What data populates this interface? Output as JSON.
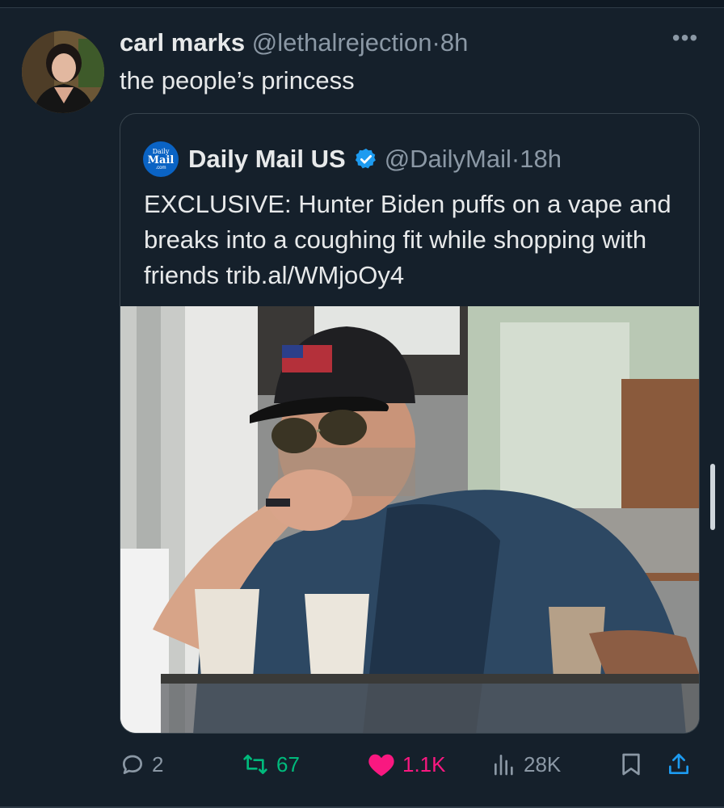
{
  "tweet": {
    "author_name": "carl marks",
    "author_handle": "@lethalrejection",
    "separator": "·",
    "time": "8h",
    "text": "the people’s princess",
    "more_label": "•••"
  },
  "quote": {
    "logo_lines": [
      "Daily",
      "Mail",
      ".com"
    ],
    "author_name": "Daily Mail US",
    "verified": true,
    "author_handle": "@DailyMail",
    "separator": "·",
    "time": "18h",
    "text": "EXCLUSIVE: Hunter Biden puffs on a vape and breaks into a coughing fit while shopping with friends trib.al/WMjoOy4"
  },
  "actions": {
    "replies": "2",
    "reposts": "67",
    "likes": "1.1K",
    "views": "28K"
  },
  "colors": {
    "background": "#15202b",
    "text": "#e7e9ea",
    "muted": "#8b98a5",
    "repost_green": "#00ba7c",
    "like_pink": "#f91880",
    "verified_blue": "#1d9bf0",
    "share_blue": "#1d9bf0"
  }
}
